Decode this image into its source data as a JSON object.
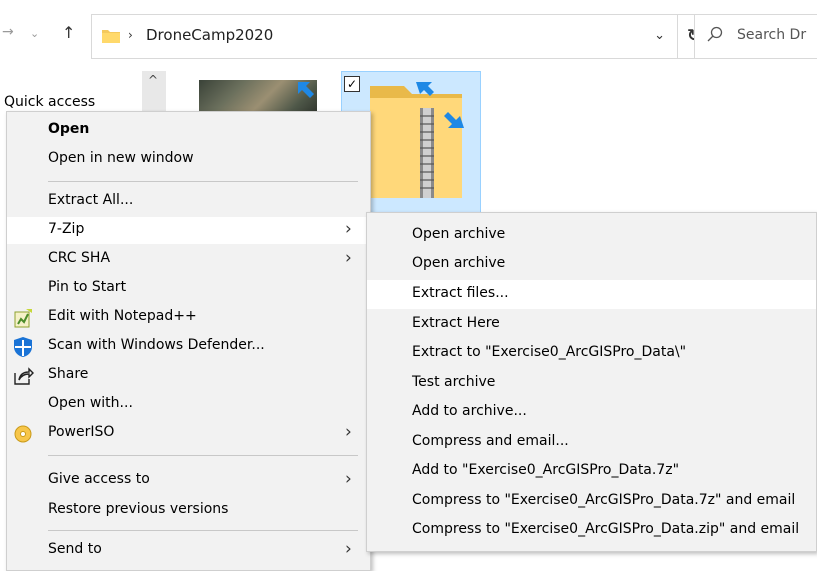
{
  "address_bar": {
    "path": "DroneCamp2020",
    "search_placeholder": "Search Dr"
  },
  "nav_pane": {
    "quick_access": "Quick access"
  },
  "context_menu": {
    "items": [
      {
        "label": "Open"
      },
      {
        "label": "Open in new window"
      },
      {
        "label": "Extract All..."
      },
      {
        "label": "7-Zip"
      },
      {
        "label": "CRC SHA"
      },
      {
        "label": "Pin to Start"
      },
      {
        "label": "Edit with Notepad++"
      },
      {
        "label": "Scan with Windows Defender..."
      },
      {
        "label": "Share"
      },
      {
        "label": "Open with..."
      },
      {
        "label": "PowerISO"
      },
      {
        "label": "Give access to"
      },
      {
        "label": "Restore previous versions"
      },
      {
        "label": "Send to"
      }
    ]
  },
  "submenu_7zip": {
    "items": [
      {
        "label": "Open archive"
      },
      {
        "label": "Open archive"
      },
      {
        "label": "Extract files..."
      },
      {
        "label": "Extract Here"
      },
      {
        "label": "Extract to \"Exercise0_ArcGISPro_Data\\\""
      },
      {
        "label": "Test archive"
      },
      {
        "label": "Add to archive..."
      },
      {
        "label": "Compress and email..."
      },
      {
        "label": "Add to \"Exercise0_ArcGISPro_Data.7z\""
      },
      {
        "label": "Compress to \"Exercise0_ArcGISPro_Data.7z\" and email"
      },
      {
        "label": "Compress to \"Exercise0_ArcGISPro_Data.zip\" and email"
      }
    ]
  },
  "colors": {
    "menu_bg": "#f2f2f2",
    "selection_bg": "#cce8ff",
    "highlight_bg": "#ffffff"
  }
}
